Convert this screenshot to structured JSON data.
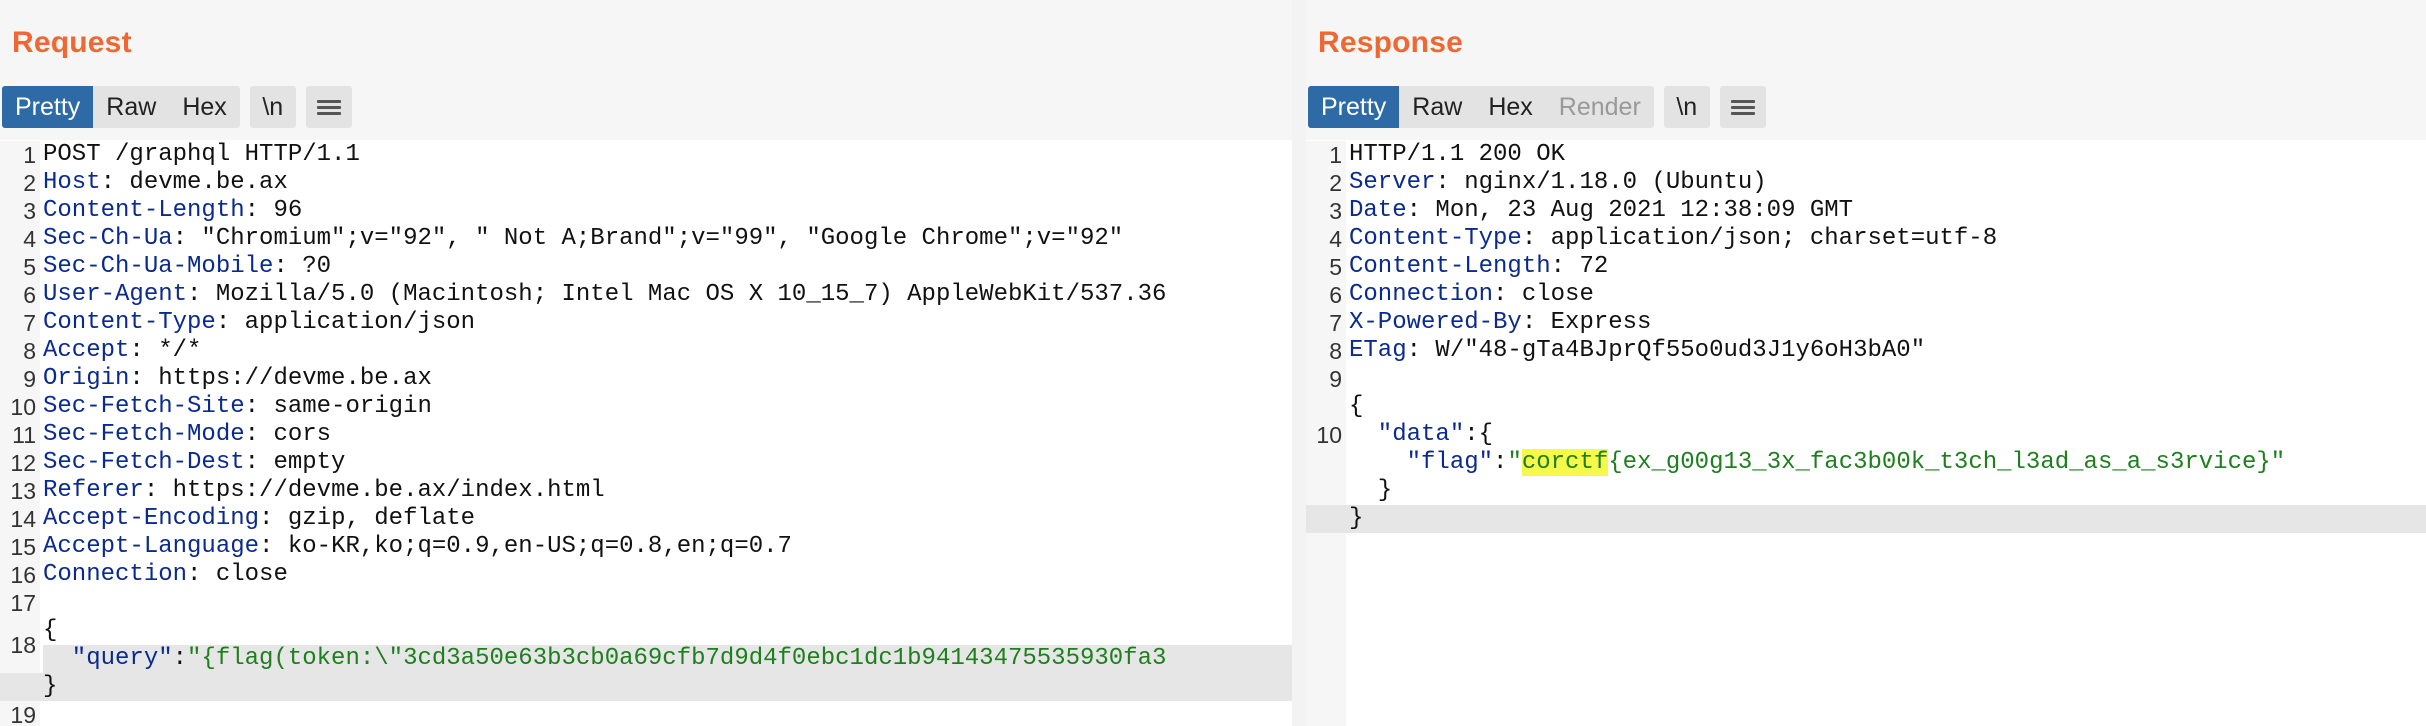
{
  "request": {
    "title": "Request",
    "tabs": [
      "Pretty",
      "Raw",
      "Hex"
    ],
    "newline_button": "\\n",
    "lines": [
      {
        "n": "1",
        "k": "",
        "v": "POST /graphql HTTP/1.1"
      },
      {
        "n": "2",
        "k": "Host",
        "v": " devme.be.ax"
      },
      {
        "n": "3",
        "k": "Content-Length",
        "v": " 96"
      },
      {
        "n": "4",
        "k": "Sec-Ch-Ua",
        "v": " \"Chromium\";v=\"92\", \" Not A;Brand\";v=\"99\", \"Google Chrome\";v=\"92\""
      },
      {
        "n": "5",
        "k": "Sec-Ch-Ua-Mobile",
        "v": " ?0"
      },
      {
        "n": "6",
        "k": "User-Agent",
        "v": " Mozilla/5.0 (Macintosh; Intel Mac OS X 10_15_7) AppleWebKit/537.36"
      },
      {
        "n": "7",
        "k": "Content-Type",
        "v": " application/json"
      },
      {
        "n": "8",
        "k": "Accept",
        "v": " */*"
      },
      {
        "n": "9",
        "k": "Origin",
        "v": " https://devme.be.ax"
      },
      {
        "n": "10",
        "k": "Sec-Fetch-Site",
        "v": " same-origin"
      },
      {
        "n": "11",
        "k": "Sec-Fetch-Mode",
        "v": " cors"
      },
      {
        "n": "12",
        "k": "Sec-Fetch-Dest",
        "v": " empty"
      },
      {
        "n": "13",
        "k": "Referer",
        "v": " https://devme.be.ax/index.html"
      },
      {
        "n": "14",
        "k": "Accept-Encoding",
        "v": " gzip, deflate"
      },
      {
        "n": "15",
        "k": "Accept-Language",
        "v": " ko-KR,ko;q=0.9,en-US;q=0.8,en;q=0.7"
      },
      {
        "n": "16",
        "k": "Connection",
        "v": " close"
      },
      {
        "n": "17",
        "k": "",
        "v": ""
      }
    ],
    "body": {
      "n_open": "18",
      "open_brace": "{",
      "query_key": "  \"query\"",
      "query_sep": ":",
      "query_value": "\"{flag(token:\\\"3cd3a50e63b3cb0a69cfb7d9d4f0ebc1dc1b94143475535930fa3",
      "n_close": "19",
      "close_brace": "}"
    }
  },
  "response": {
    "title": "Response",
    "tabs": [
      "Pretty",
      "Raw",
      "Hex",
      "Render"
    ],
    "newline_button": "\\n",
    "lines": [
      {
        "n": "1",
        "k": "",
        "v": "HTTP/1.1 200 OK"
      },
      {
        "n": "2",
        "k": "Server",
        "v": " nginx/1.18.0 (Ubuntu)"
      },
      {
        "n": "3",
        "k": "Date",
        "v": " Mon, 23 Aug 2021 12:38:09 GMT"
      },
      {
        "n": "4",
        "k": "Content-Type",
        "v": " application/json; charset=utf-8"
      },
      {
        "n": "5",
        "k": "Content-Length",
        "v": " 72"
      },
      {
        "n": "6",
        "k": "Connection",
        "v": " close"
      },
      {
        "n": "7",
        "k": "X-Powered-By",
        "v": " Express"
      },
      {
        "n": "8",
        "k": "ETag",
        "v": " W/\"48-gTa4BJprQf55o0ud3J1y6oH3bA0\""
      },
      {
        "n": "9",
        "k": "",
        "v": ""
      }
    ],
    "body": {
      "n_open": "10",
      "open_brace": "{",
      "data_key": "  \"data\"",
      "data_sep": ":{",
      "flag_key": "    \"flag\"",
      "flag_sep": ":",
      "flag_quote_open": "\"",
      "flag_highlight": "corctf",
      "flag_rest": "{ex_g00g13_3x_fac3b00k_t3ch_l3ad_as_a_s3rvice}\"",
      "inner_close": "  }",
      "close_brace": "}"
    }
  },
  "colors": {
    "title_orange": "#ef6833",
    "active_tab_blue": "#2e6aa6",
    "header_key_blue": "#0a2a8f",
    "string_green": "#1d7f1d",
    "search_highlight_yellow": "#f6f84a"
  }
}
